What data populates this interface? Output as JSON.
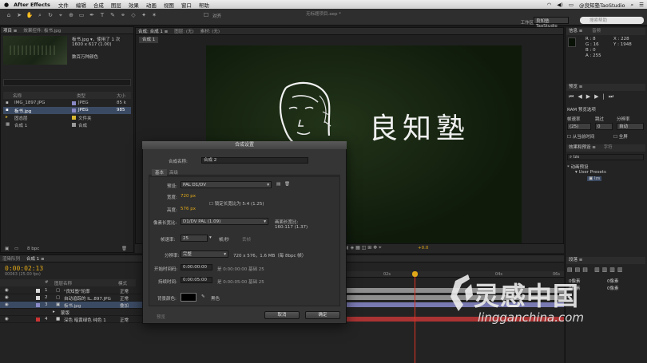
{
  "menubar": {
    "apple": "",
    "app_name": "After Effects",
    "items": [
      "文件",
      "编辑",
      "合成",
      "图层",
      "效果",
      "动画",
      "视图",
      "窗口",
      "帮助"
    ],
    "right_text": "@良知塾TaoStudio"
  },
  "toolbar": {
    "doc_title": "无标题项目.aep *",
    "snap_label": "对齐",
    "workspace_label": "工作区:",
    "workspace_value": "良知塾TaoStudio",
    "search_placeholder": "搜索帮助"
  },
  "project": {
    "tabs": [
      "项目 ≡",
      "效果控件: 板书.jpg"
    ],
    "selected_name": "板书.jpg ▾，使用了 1 次",
    "selected_size": "1600 x 617 (1.00)",
    "selected_color": "数百万种颜色",
    "list_header": {
      "name": "名称",
      "type": "类型",
      "size": "大小"
    },
    "items": [
      {
        "name": "IMG_1897.JPG",
        "type": "JPEG",
        "size": "85 k",
        "color": "#8a8ac8",
        "selected": false
      },
      {
        "name": "板书.jpg",
        "type": "JPEG",
        "size": "985",
        "color": "#8a8ac8",
        "selected": true
      },
      {
        "name": "固态层",
        "type": "文件夹",
        "size": "",
        "color": "#d8b830",
        "selected": false
      },
      {
        "name": "合成 1",
        "type": "合成",
        "size": "",
        "color": "#9a9a9a",
        "selected": false
      }
    ],
    "bpc": "8 bpc"
  },
  "viewer": {
    "tabs": [
      "合成: 合成 1 ≡",
      "图层: (无)",
      "素材: (无)"
    ],
    "comp_tab": "合成 1",
    "title_text": "良知塾",
    "timecode": "+0.0"
  },
  "info": {
    "tabs": [
      "信息 ≡",
      "音频"
    ],
    "r": "R : 8",
    "g": "G : 16",
    "b": "B : 0",
    "a": "A : 255",
    "x": "X : 228",
    "y": "Y : 1948"
  },
  "preview": {
    "title": "预览 ≡",
    "ram_label": "RAM 预览选项",
    "frame_rate_label": "帧速率",
    "skip_label": "跳过",
    "resolution_label": "分辨率",
    "frame_rate": "(25)",
    "skip": "0",
    "resolution": "自动",
    "from_current": "从当前时间",
    "fullscreen": "全屏"
  },
  "effects": {
    "title": "效果和预设 ≡",
    "tab2": "字符",
    "search_value": "lzs",
    "tree": [
      "* 动画预设",
      "User Presets",
      "lzs"
    ]
  },
  "align": {
    "title": "段落 ≡",
    "labels": [
      "0像素",
      "0像素",
      "0像素",
      "0像素"
    ]
  },
  "timeline": {
    "tabs": [
      "渲染队列",
      "合成 1 ≡"
    ],
    "timecode": "0:00:02:13",
    "timecode_sub": "00063 (25.00 fps)",
    "header": {
      "num": "#",
      "name": "图层名称",
      "mode": "模式"
    },
    "layers": [
      {
        "num": "1",
        "name": "\"良知塾\"轮廓",
        "mode": "正常",
        "color": "#d8d8d8",
        "selected": false
      },
      {
        "num": "2",
        "name": "自动追踪的 IL..897.JPG",
        "mode": "正常",
        "color": "#d8d8d8",
        "selected": false
      },
      {
        "num": "3",
        "name": "板书.jpg",
        "mode": "叠加",
        "color": "#8a8ac8",
        "selected": true
      },
      {
        "num": "",
        "name": "蒙版",
        "mode": "",
        "color": "",
        "selected": false
      },
      {
        "num": "4",
        "name": "深色 暗黄绿色 纯色 1",
        "mode": "正常",
        "color": "#c33",
        "selected": false
      }
    ],
    "ruler": [
      "02s",
      "04s",
      "06s"
    ]
  },
  "dialog": {
    "title": "合成设置",
    "name_label": "合成名称:",
    "name_value": "合成 2",
    "tab_basic": "基本",
    "tab_advanced": "高级",
    "preset_label": "预设:",
    "preset_value": "PAL D1/DV",
    "width_label": "宽度:",
    "width_value": "720 px",
    "height_label": "高度:",
    "height_value": "576 px",
    "lock_label": "锁定长宽比为 5:4 (1.25)",
    "pixel_aspect_label": "像素长宽比:",
    "pixel_aspect_value": "D1/DV PAL (1.09)",
    "frame_aspect_label": "画面长宽比:",
    "frame_aspect_value": "160:117 (1.37)",
    "frame_rate_label": "帧速率:",
    "frame_rate_value": "25",
    "frame_rate_unit": "帧/秒",
    "drop_frame": "丢帧",
    "resolution_label": "分辨率:",
    "resolution_value": "完整",
    "resolution_info": "720 x 576，1.6 MB（每 8bpc 帧）",
    "start_label": "开始时间码:",
    "start_value": "0:00:00:00",
    "start_info": "是 0:00:00:00 基础 25",
    "duration_label": "持续时间:",
    "duration_value": "0:00:05:00",
    "duration_info": "是 0:00:05:00 基础 25",
    "bg_label": "背景颜色:",
    "bg_name": "黑色",
    "preview_btn": "预览",
    "cancel_btn": "取消",
    "ok_btn": "确定"
  },
  "watermark": {
    "text": "灵感中国",
    "url": "lingganchina.com"
  }
}
